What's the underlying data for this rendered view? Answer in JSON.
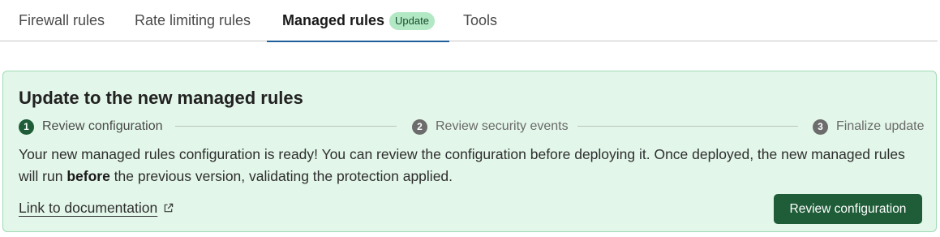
{
  "tabs": [
    {
      "label": "Firewall rules"
    },
    {
      "label": "Rate limiting rules"
    },
    {
      "label": "Managed rules",
      "badge": "Update",
      "active": true
    },
    {
      "label": "Tools"
    }
  ],
  "panel": {
    "title": "Update to the new managed rules",
    "steps": [
      {
        "number": "1",
        "label": "Review configuration",
        "state": "complete"
      },
      {
        "number": "2",
        "label": "Review security events",
        "state": "pending"
      },
      {
        "number": "3",
        "label": "Finalize update",
        "state": "pending"
      }
    ],
    "description_pre": "Your new managed rules configuration is ready! You can review the configuration before deploying it. Once deployed, the new managed rules will run ",
    "description_bold": "before",
    "description_post": " the previous version, validating the protection applied.",
    "doc_link": "Link to documentation",
    "doc_link_icon": "external-link-icon",
    "action_button": "Review configuration"
  },
  "colors": {
    "panel_background": "#e2f6e9",
    "panel_border": "#9fdbb3",
    "primary_button": "#1f5c38",
    "active_tab_underline": "#1f5f99",
    "badge_background": "#b2e8c4"
  }
}
